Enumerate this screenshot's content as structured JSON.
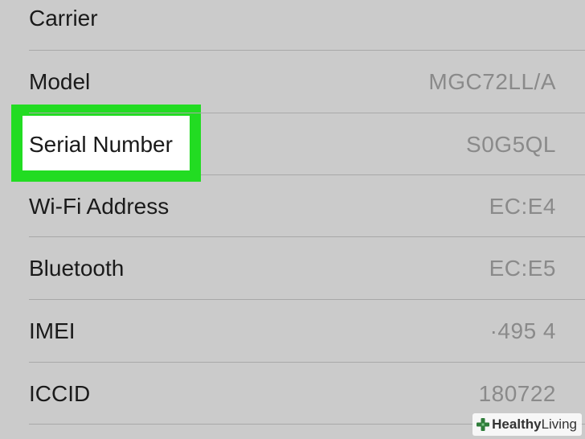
{
  "rows": [
    {
      "label": "Carrier",
      "value": ""
    },
    {
      "label": "Model",
      "value": "MGC72LL/A"
    },
    {
      "label": "Serial Number",
      "value": "S0G5QL"
    },
    {
      "label": "Wi-Fi Address",
      "value": "EC:E4"
    },
    {
      "label": "Bluetooth",
      "value": "EC:E5"
    },
    {
      "label": "IMEI",
      "value": "·495 4"
    },
    {
      "label": "ICCID",
      "value": "180722"
    }
  ],
  "highlighted_row": "Serial Number",
  "colors": {
    "background": "#cbcbcb",
    "highlight_border": "#22dc22",
    "label_text": "#1a1a1a",
    "value_text": "#8a8a8a"
  },
  "watermark": {
    "bold": "Healthy",
    "normal": " Living",
    "icon": "plus-leaf-icon"
  }
}
